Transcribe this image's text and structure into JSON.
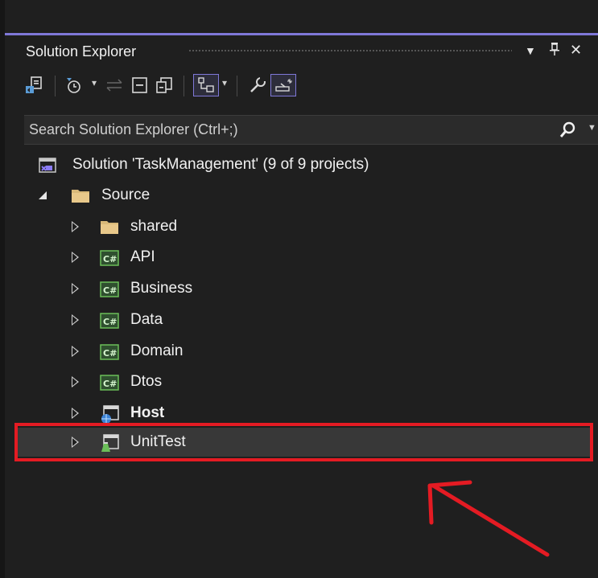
{
  "panel": {
    "title": "Solution Explorer",
    "buttons": {
      "dropdown": "▼",
      "pin": "📌",
      "close": "✕"
    },
    "accent_color": "#7f78d8"
  },
  "toolbar": {
    "items": [
      "sync-icon",
      "history-icon",
      "back-forward-icon",
      "collapse-all-icon",
      "copy-icon",
      "show-all-files-icon",
      "properties-icon",
      "preview-icon"
    ]
  },
  "search": {
    "placeholder": "Search Solution Explorer (Ctrl+;)"
  },
  "tree": {
    "solution": "Solution 'TaskManagement' (9 of 9 projects)",
    "source": "Source",
    "items": [
      {
        "label": "shared",
        "icon": "folder-icon"
      },
      {
        "label": "API",
        "icon": "csharp-project-icon"
      },
      {
        "label": "Business",
        "icon": "csharp-project-icon"
      },
      {
        "label": "Data",
        "icon": "csharp-project-icon"
      },
      {
        "label": "Domain",
        "icon": "csharp-project-icon"
      },
      {
        "label": "Dtos",
        "icon": "csharp-project-icon"
      },
      {
        "label": "Host",
        "icon": "web-project-icon",
        "bold": true
      },
      {
        "label": "UnitTest",
        "icon": "test-project-icon",
        "selected": true
      }
    ]
  },
  "annotation": {
    "highlight_color": "#e41b23",
    "arrow_color": "#e41b23"
  }
}
